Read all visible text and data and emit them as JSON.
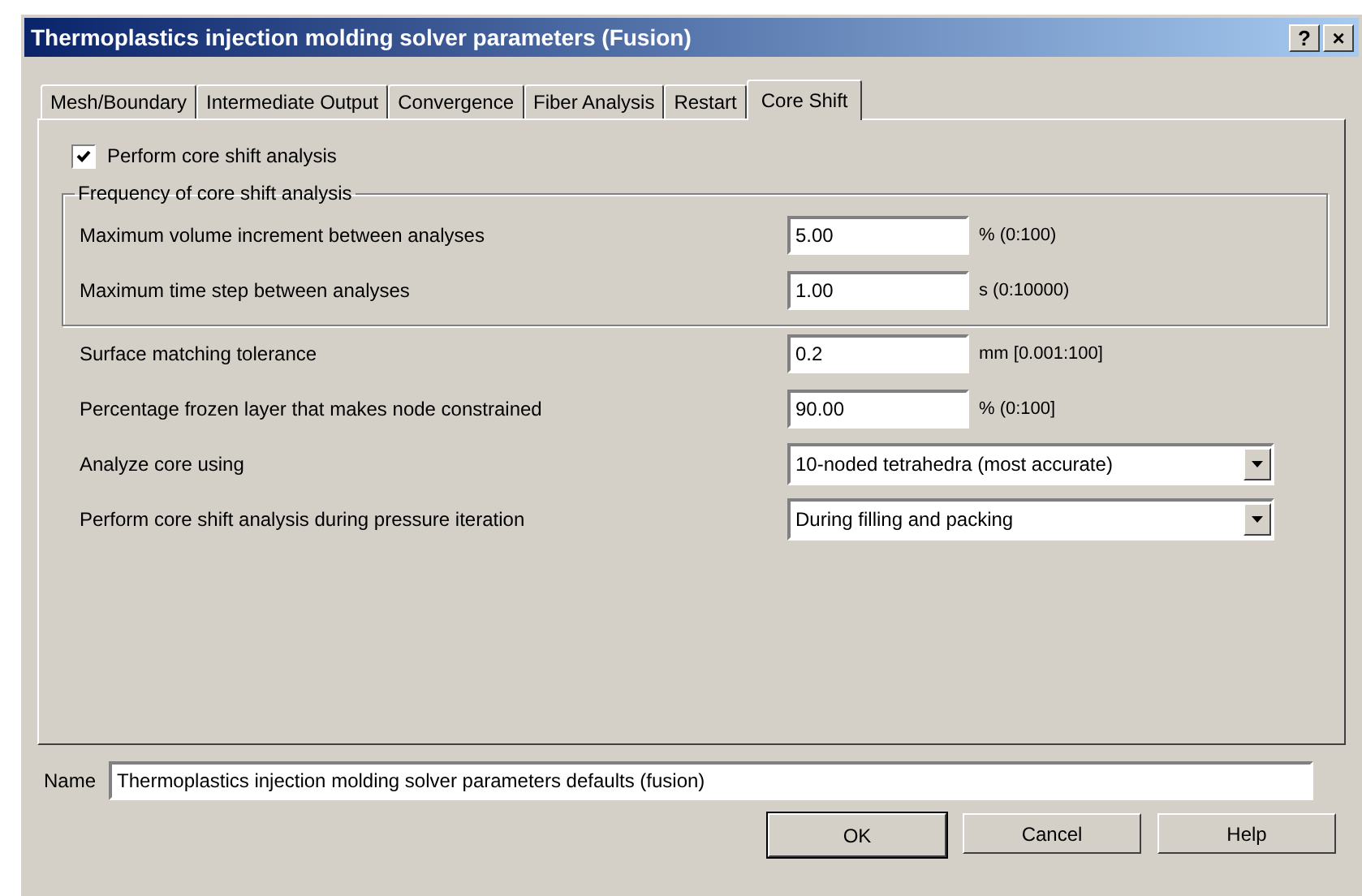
{
  "window": {
    "title": "Thermoplastics injection molding solver parameters (Fusion)",
    "title_buttons": [
      "?",
      "×"
    ]
  },
  "tabs": [
    {
      "label": "Mesh/Boundary",
      "selected": false
    },
    {
      "label": "Intermediate Output",
      "selected": false
    },
    {
      "label": "Convergence",
      "selected": false
    },
    {
      "label": "Fiber Analysis",
      "selected": false
    },
    {
      "label": "Restart",
      "selected": false
    },
    {
      "label": "Core Shift",
      "selected": true
    }
  ],
  "perform_checkbox": {
    "label": "Perform core shift analysis",
    "checked": true
  },
  "frequency_group": {
    "title": "Frequency of core shift analysis",
    "rows": [
      {
        "kind": "input",
        "label": "Maximum volume increment between analyses",
        "value": "5.00",
        "unit": "% (0:100)"
      },
      {
        "kind": "input",
        "label": "Maximum time step between analyses",
        "value": "1.00",
        "unit": "s (0:10000)"
      }
    ]
  },
  "rows": [
    {
      "kind": "input",
      "label": "Surface matching tolerance",
      "value": "0.2",
      "unit": "mm [0.001:100]"
    },
    {
      "kind": "input",
      "label": "Percentage frozen layer that makes node constrained",
      "value": "90.00",
      "unit": "% (0:100]"
    },
    {
      "kind": "select",
      "label": "Analyze core using",
      "value": "10-noded tetrahedra (most accurate)"
    },
    {
      "kind": "select",
      "label": "Perform core shift analysis during pressure iteration",
      "value": "During filling and packing"
    }
  ],
  "name_field": {
    "label": "Name",
    "value": "Thermoplastics injection molding solver parameters defaults (fusion)"
  },
  "buttons": [
    {
      "label": "OK",
      "default": true
    },
    {
      "label": "Cancel",
      "default": false
    },
    {
      "label": "Help",
      "default": false
    }
  ]
}
